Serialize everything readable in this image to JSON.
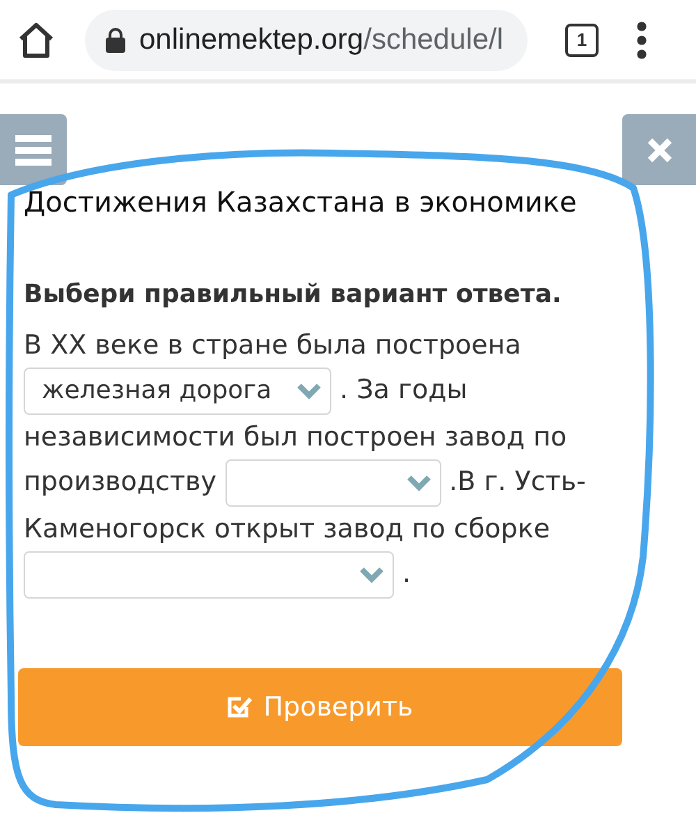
{
  "browser": {
    "url_host": "onlinemektep.org",
    "url_path": "/schedule/l",
    "tab_count": "1"
  },
  "lesson": {
    "title": "Достижения Казахстана в экономике",
    "instruction": "Выбери правильный вариант ответа.",
    "parts": [
      {
        "kind": "text",
        "text": "В XX веке в стране была построена"
      },
      {
        "kind": "dropdown",
        "value": "железная дорога"
      },
      {
        "kind": "text",
        "text": ". За годы"
      },
      {
        "kind": "text",
        "text": "независимости был построен завод по"
      },
      {
        "kind": "text",
        "text": "производству"
      },
      {
        "kind": "dropdown"
      },
      {
        "kind": "text",
        "text": ".В г. Усть-"
      },
      {
        "kind": "text",
        "text": "Каменогорск открыт завод по сборке"
      },
      {
        "kind": "dropdown",
        "wide": true
      },
      {
        "kind": "text",
        "text": "."
      }
    ],
    "check_button": "Проверить"
  }
}
